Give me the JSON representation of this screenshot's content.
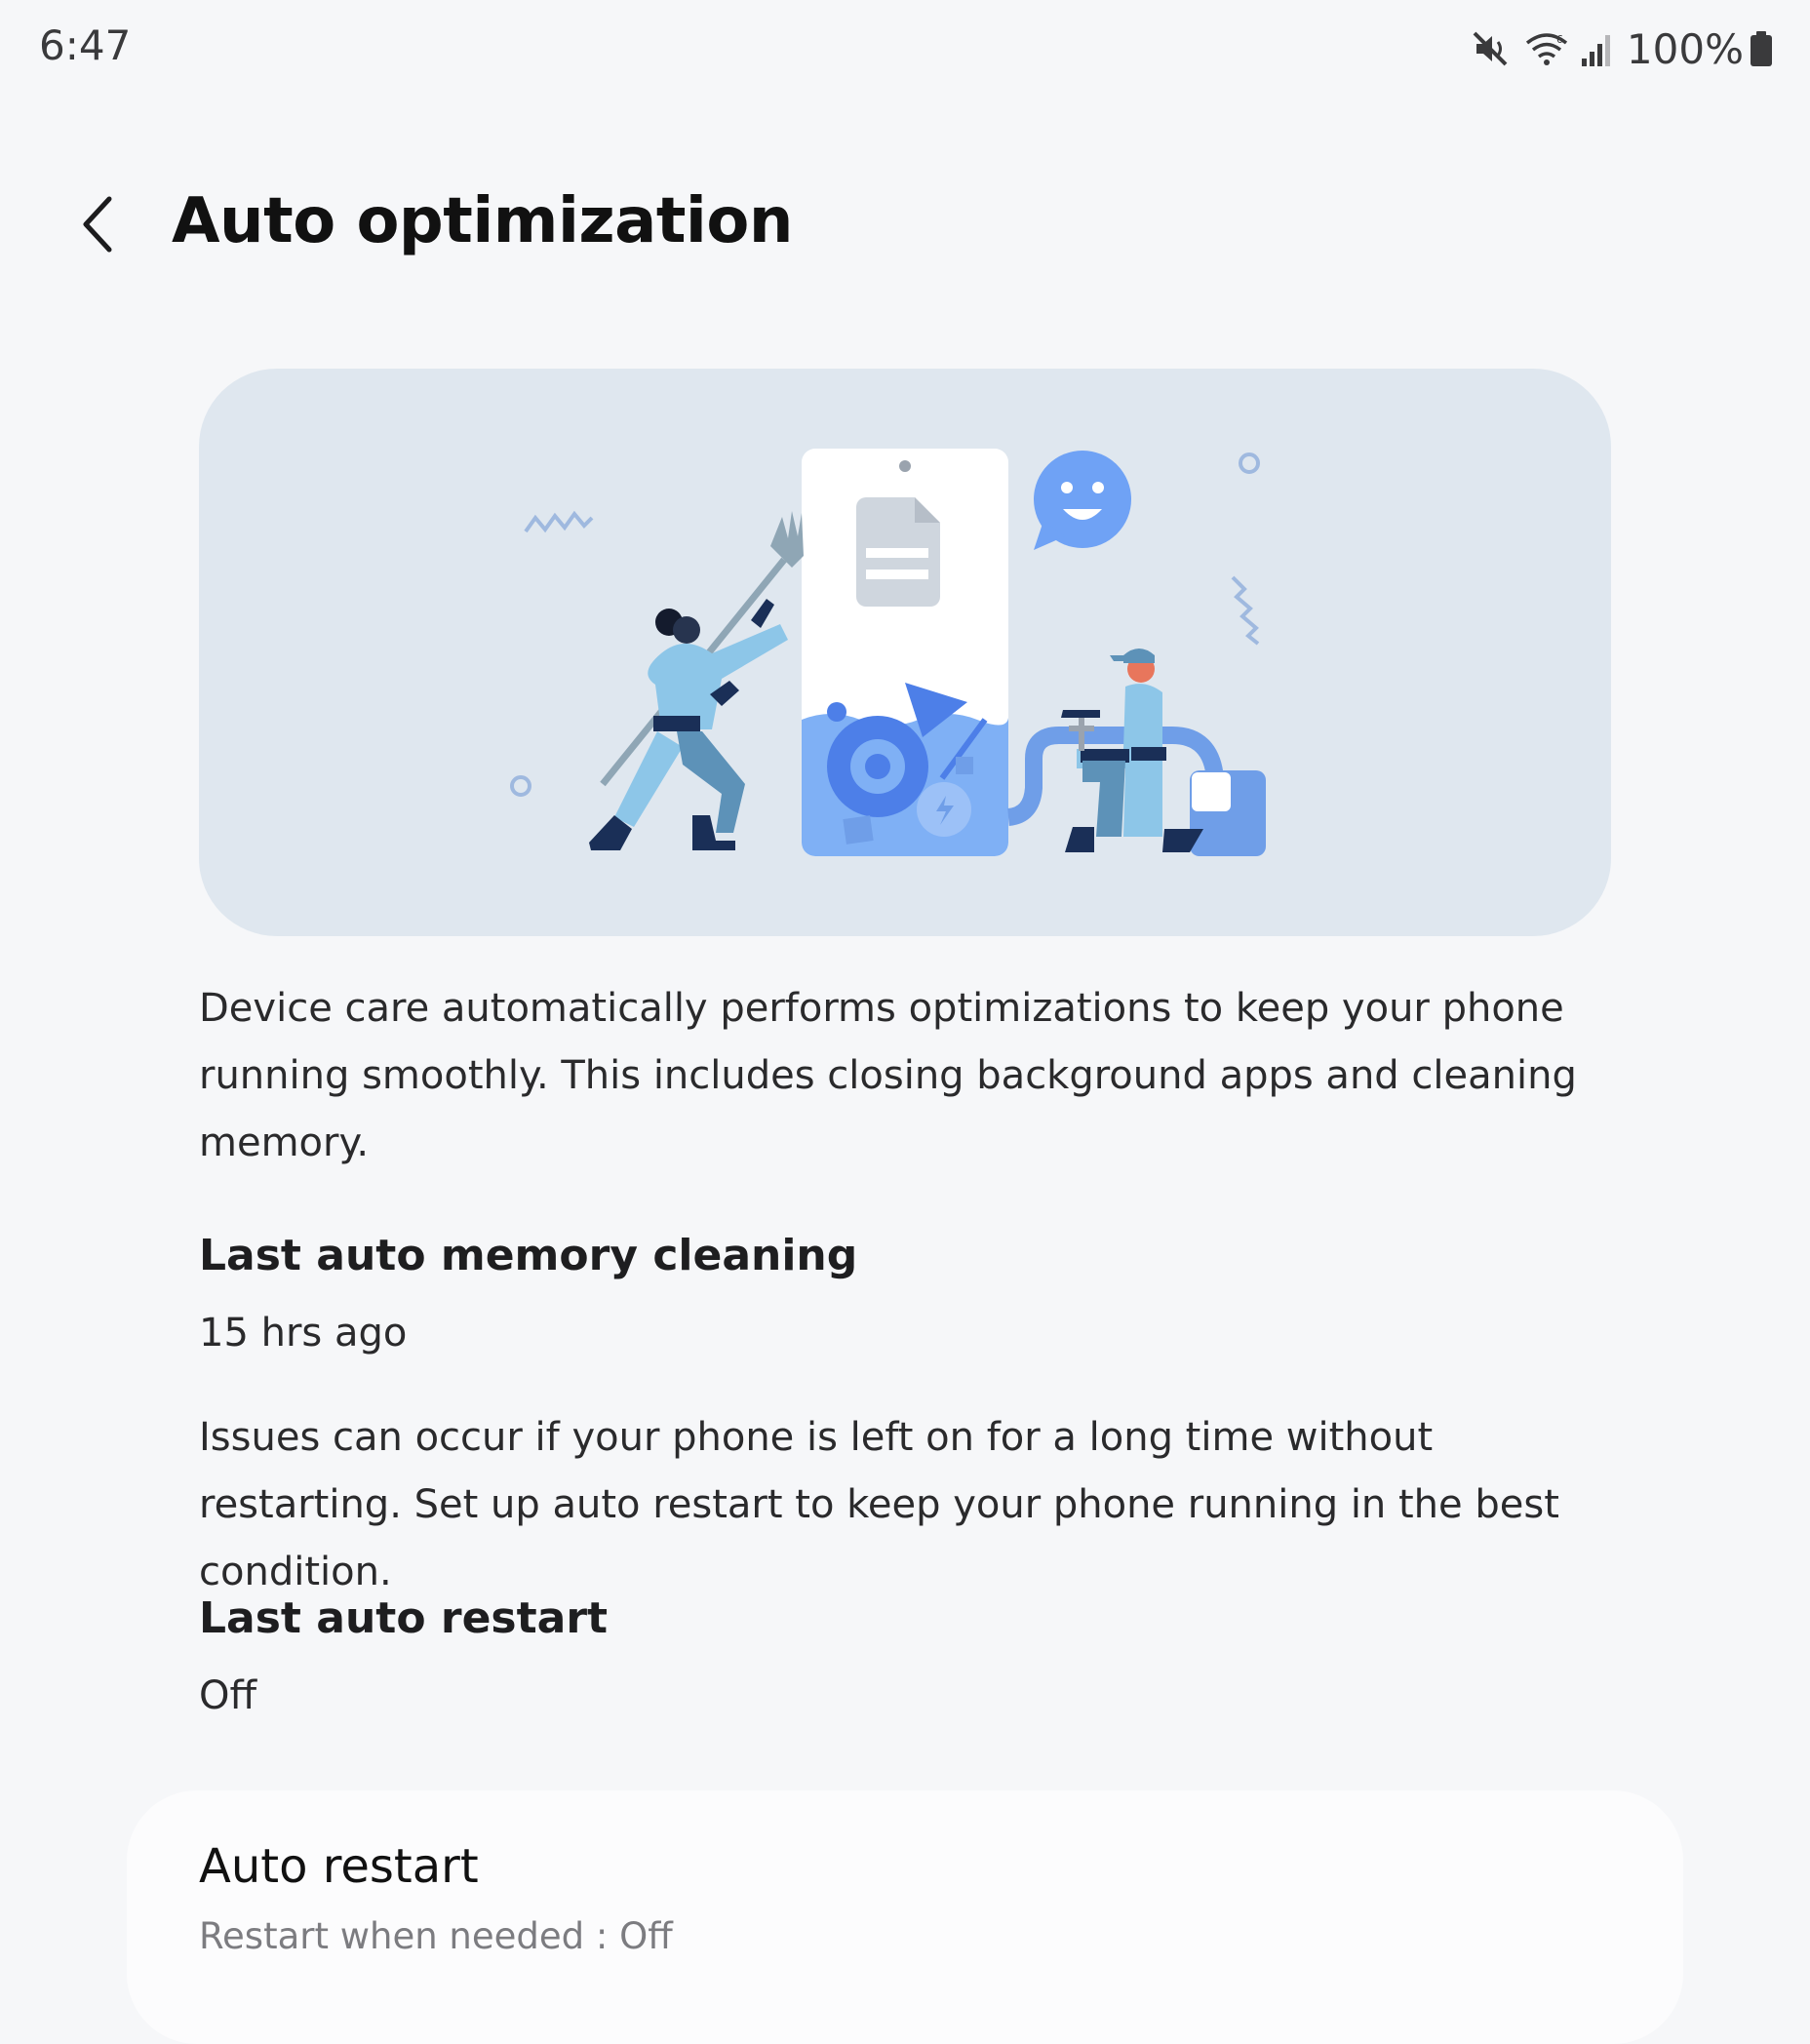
{
  "status_bar": {
    "time": "6:47",
    "battery_percent": "100%",
    "icons": [
      "mute-icon",
      "wifi-icon",
      "signal-icon",
      "battery-icon"
    ]
  },
  "header": {
    "title": "Auto optimization",
    "back_icon": "chevron-left-icon"
  },
  "hero": {
    "illustration": "device-care-illustration",
    "colors": {
      "card_bg": "#dfe7ef",
      "accent_blue": "#4d7fe8",
      "light_blue": "#7fb0f5",
      "navy": "#1a2f57",
      "sky": "#8dc6e8"
    }
  },
  "content": {
    "description": "Device care automatically performs optimizations to keep your phone running smoothly. This includes closing background apps and cleaning memory.",
    "memory_title": "Last auto memory cleaning",
    "memory_value": "15 hrs ago",
    "restart_description": "Issues can occur if your phone is left on for a long time without restarting. Set up auto restart to keep your phone running in the best condition.",
    "restart_title": "Last auto restart",
    "restart_value": "Off"
  },
  "auto_restart_card": {
    "title": "Auto restart",
    "subtitle": "Restart when needed : Off"
  }
}
